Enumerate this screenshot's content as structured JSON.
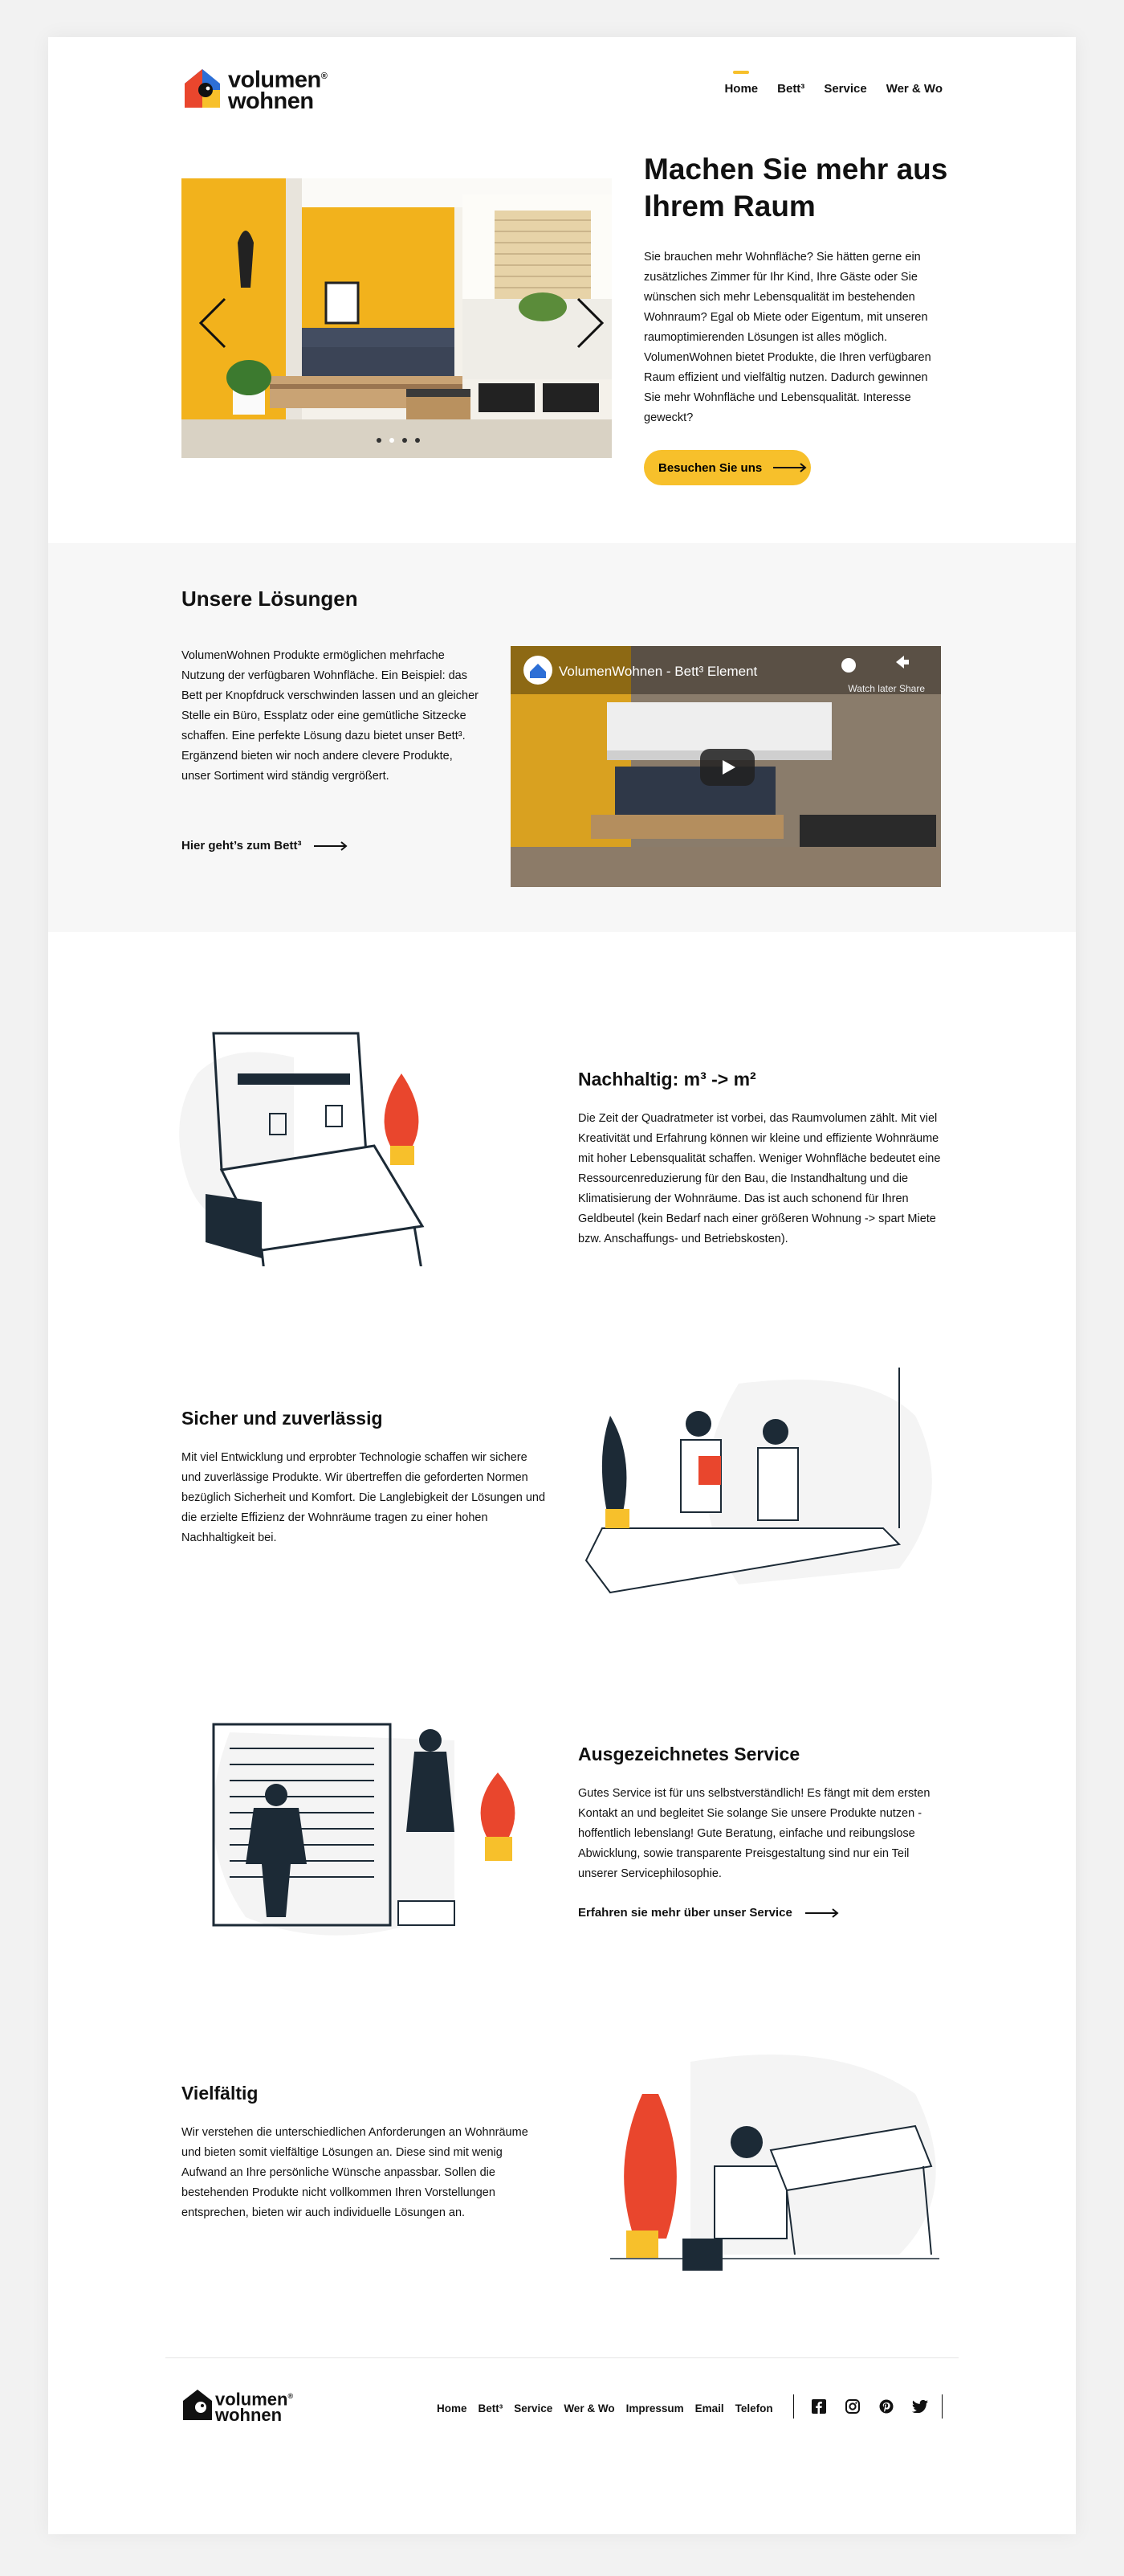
{
  "brand": {
    "line1": "volumen",
    "line2": "wohnen",
    "reg": "®",
    "yellow": "#f7c02b",
    "red": "#e9462d",
    "blue": "#2d6fd6"
  },
  "nav": [
    "Home",
    "Bett³",
    "Service",
    "Wer & Wo"
  ],
  "hero": {
    "title": "Machen Sie mehr aus Ihrem Raum",
    "text": "Sie brauchen mehr Wohnfläche? Sie hätten gerne ein zusätzliches Zimmer für Ihr Kind, Ihre Gäste oder Sie wünschen sich mehr Lebensqualität im bestehenden Wohnraum? Egal ob Miete oder Eigentum, mit unseren raumoptimierenden Lösungen ist alles möglich. VolumenWohnen bietet Produkte, die Ihren verfügbaren Raum effizient und vielfältig nutzen. Dadurch gewinnen Sie mehr Wohnfläche und Lebensqualität. Interesse geweckt?",
    "button": "Besuchen Sie uns"
  },
  "solutions": {
    "title": "Unsere Lösungen",
    "text": "VolumenWohnen Produkte ermöglichen mehrfache Nutzung der verfügbaren Wohnfläche. Ein Beispiel: das Bett per Knopfdruck verschwinden lassen und an gleicher Stelle ein Büro, Essplatz oder eine gemütliche Sitzecke schaffen. Eine perfekte Lösung dazu bietet unser Bett³. Ergänzend bieten wir noch andere clevere Produkte, unser Sortiment wird ständig vergrößert.",
    "link": "Hier geht’s zum Bett³",
    "video_title": "VolumenWohnen - Bett³ Element",
    "video_sub": "Watch later   Share"
  },
  "features": [
    {
      "title": "Nachhaltig: m³ -> m²",
      "text": "Die Zeit der Quadratmeter ist vorbei, das Raumvolumen zählt. Mit viel Kreativität und Erfahrung können wir kleine und effiziente Wohnräume mit hoher Lebensqualität schaffen. Weniger Wohnfläche bedeutet eine Ressourcenreduzierung für den Bau, die Instandhaltung und die Klimatisierung der Wohnräume. Das ist auch schonend für Ihren Geldbeutel (kein Bedarf nach einer größeren Wohnung -> spart Miete bzw. Anschaffungs- und Betriebskosten)."
    },
    {
      "title": "Sicher und zuverlässig",
      "text": "Mit viel Entwicklung und erprobter Technologie schaffen wir sichere und zuverlässige Produkte. Wir übertreffen die geforderten Normen bezüglich Sicherheit und Komfort. Die Langlebigkeit der Lösungen und die erzielte Effizienz der Wohnräume tragen zu einer hohen Nachhaltigkeit bei."
    },
    {
      "title": "Ausgezeichnetes Service",
      "text": "Gutes Service ist für uns selbstverständlich! Es fängt mit dem ersten Kontakt an und begleitet Sie solange Sie unsere Produkte nutzen - hoffentlich lebenslang! Gute Beratung, einfache und reibungslose Abwicklung, sowie transparente Preisgestaltung sind nur ein Teil unserer Servicephilosophie.",
      "link": "Erfahren sie mehr über unser Service"
    },
    {
      "title": "Vielfältig",
      "text": "Wir verstehen die unterschiedlichen Anforderungen an Wohnräume und bieten somit vielfältige Lösungen an. Diese sind mit wenig Aufwand an Ihre persönliche Wünsche anpassbar. Sollen die bestehenden Produkte nicht vollkommen Ihren Vorstellungen entsprechen, bieten wir auch individuelle Lösungen an."
    }
  ],
  "footer": {
    "links": [
      "Home",
      "Bett³",
      "Service",
      "Wer & Wo",
      "Impressum",
      "Email",
      "Telefon"
    ],
    "socials": [
      "facebook-icon",
      "instagram-icon",
      "pinterest-icon",
      "twitter-icon"
    ]
  }
}
